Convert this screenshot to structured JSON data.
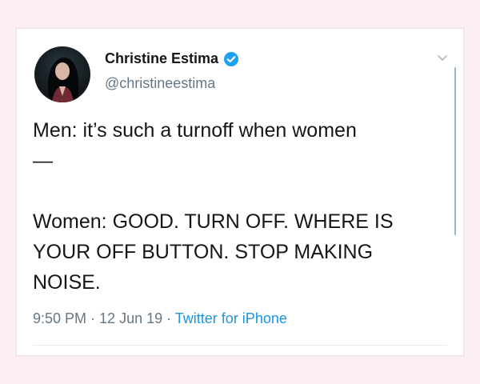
{
  "author": {
    "display_name": "Christine Estima",
    "handle": "@christineestima",
    "verified": true,
    "avatar_icon": "profile-photo"
  },
  "tweet": {
    "lines": [
      "Men: it’s such a turnoff when women",
      "—",
      "",
      "Women: GOOD. TURN OFF. WHERE IS",
      "YOUR OFF BUTTON. STOP MAKING",
      "NOISE."
    ]
  },
  "meta": {
    "time": "9:50 PM",
    "separator": " · ",
    "date": "12 Jun 19",
    "source": "Twitter for iPhone"
  },
  "colors": {
    "background": "#fbeef1",
    "verified_badge": "#1da1f2",
    "link": "#1b95e0",
    "secondary_text": "#657786"
  },
  "icons": {
    "menu": "chevron-down-icon",
    "verified": "verified-badge-icon"
  }
}
